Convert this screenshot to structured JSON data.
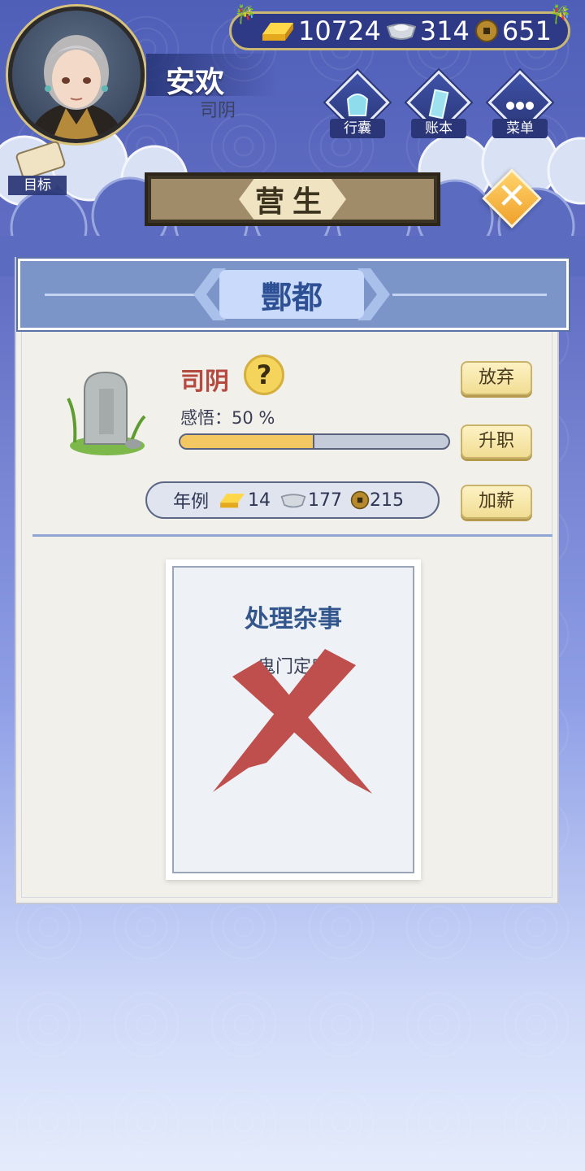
{
  "player": {
    "name": "安欢",
    "title": "司阴"
  },
  "currency": {
    "gold": "10724",
    "silver": "314",
    "copper": "651"
  },
  "menu": [
    {
      "label": "行囊",
      "icon": "bag-icon"
    },
    {
      "label": "账本",
      "icon": "ledger-icon"
    },
    {
      "label": "菜单",
      "icon": "more-icon"
    }
  ],
  "goal_label": "目标",
  "screen_title": "营生",
  "region": "酆都",
  "job": {
    "title": "司阴",
    "help": "?",
    "insight_label": "感悟：",
    "insight_value": "50 %",
    "insight_fraction": 0.5,
    "salary_label": "年例",
    "salary_gold": "14",
    "salary_silver": "177",
    "salary_copper": "215"
  },
  "actions": {
    "abandon": "放弃",
    "promote": "升职",
    "raise": "加薪"
  },
  "task": {
    "title": "处理杂事",
    "subtitle": "鬼门定序",
    "status": "failed"
  },
  "colors": {
    "accent": "#2f3a86",
    "gold_button": "#f1dd93",
    "job_title": "#b4493f",
    "fail_mark": "#bf4f4d"
  }
}
